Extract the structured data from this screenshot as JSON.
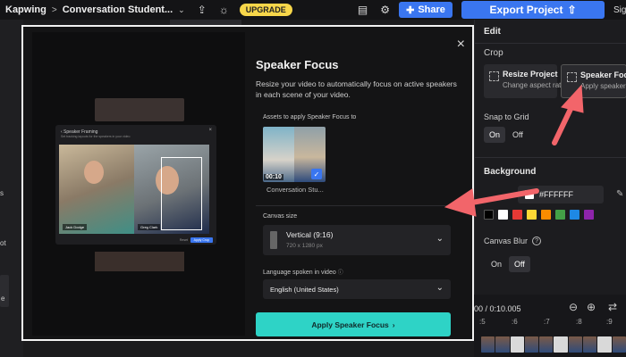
{
  "topbar": {
    "brand": "Kapwing",
    "separator": ">",
    "project_name": "Conversation Student...",
    "caret": "⌄",
    "upload_icon": "⇪",
    "bulb_icon": "☼",
    "upgrade_label": "UPGRADE",
    "chat_icon": "▤",
    "gear_icon": "⚙",
    "share_label": "Share",
    "export_label": "Export Project",
    "sign_label": "Sig"
  },
  "left_strip": {
    "labels": [
      "s",
      "ot",
      "e"
    ]
  },
  "modal": {
    "close": "×",
    "title": "Speaker Focus",
    "description": "Resize your video to automatically focus on active speakers in each scene of your video.",
    "assets_label": "Assets to apply Speaker Focus to",
    "asset": {
      "duration": "00:10",
      "name": "Conversation Stu...",
      "check": "✓"
    },
    "canvas_size_label": "Canvas size",
    "canvas_value": "Vertical (9:16)",
    "canvas_sub": "720 x 1280 px",
    "language_label": "Language spoken in video",
    "language_value": "English (United States)",
    "apply_label": "Apply Speaker Focus",
    "apply_arrow": "›",
    "demo": {
      "title": "‹  Speaker Framing",
      "subtitle": "Set tracking layouts for the speakers in your video",
      "close": "×",
      "name_left": "Jack Dodge",
      "name_right": "Greg Clark",
      "reset": "Reset",
      "apply": "Apply Crop"
    }
  },
  "right_panel": {
    "edit_label": "Edit",
    "crop_label": "Crop",
    "resize_title": "Resize Project",
    "resize_sub": "Change aspect ratio",
    "focus_title": "Speaker Focus",
    "focus_sub": "Apply speaker focus",
    "snap_label": "Snap to Grid",
    "on": "On",
    "off": "Off",
    "background_label": "Background",
    "bg_hex": "#FFFFFF",
    "pen_icon": "✎",
    "swatch_colors": [
      "#000000",
      "#ffffff",
      "#e53935",
      "#fdd835",
      "#fb8c00",
      "#43a047",
      "#1e88e5",
      "#8e24aa"
    ],
    "blur_label": "Canvas Blur",
    "help": "?"
  },
  "timeline": {
    "time": "00 / 0:10.005",
    "zoom_out": "⊖",
    "zoom_in": "⊕",
    "swap": "⇄",
    "ticks": [
      ":5",
      ":6",
      ":7",
      ":8",
      ":9"
    ]
  },
  "colors": {
    "accent_blue": "#3a76f0",
    "apply_teal": "#2ed3c6",
    "upgrade_yellow": "#f7d64a",
    "arrow_red": "#f2656a"
  }
}
